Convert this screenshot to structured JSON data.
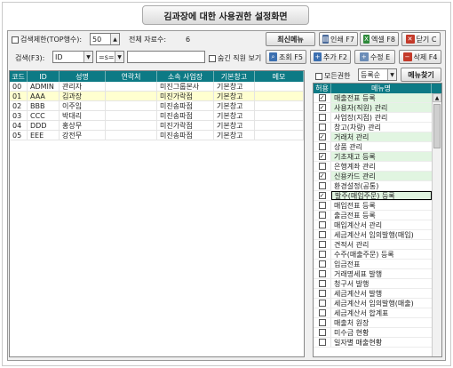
{
  "title": "김과장에 대한 사용권한 설정화면",
  "toolbar": {
    "limit_label": "검색제한(TOP행수):",
    "limit_value": "50",
    "total_label": "전체 자료수:",
    "total_value": "6",
    "refresh_label": "최신메뉴",
    "print_label": "인쇄 F7",
    "excel_label": "엑셀 F8",
    "close_label": "닫기 C"
  },
  "search": {
    "label": "검색(F3):",
    "field_value": "ID",
    "op_value": "=s=",
    "query_value": "",
    "hide_label": "숨긴 직원 보기",
    "query_btn": "조회 F5",
    "add_btn": "추가 F2",
    "edit_btn": "수정 E",
    "delete_btn": "삭제 F4"
  },
  "menu_panel": {
    "all_label": "모든권한",
    "mode_value": "등록순",
    "find_btn": "메뉴찾기",
    "col_allow": "허용",
    "col_menu": "메뉴명"
  },
  "grid": {
    "columns": [
      "코드",
      "ID",
      "성명",
      "연락처",
      "소속 사업장",
      "기본창고",
      "메모"
    ],
    "rows": [
      [
        "00",
        "ADMIN",
        "관리자",
        "",
        "미진그룹본사",
        "기본창고",
        ""
      ],
      [
        "01",
        "AAA",
        "김과장",
        "",
        "미진가락점",
        "기본창고",
        ""
      ],
      [
        "02",
        "BBB",
        "이주임",
        "",
        "미진송파점",
        "기본창고",
        ""
      ],
      [
        "03",
        "CCC",
        "박대리",
        "",
        "미진송파점",
        "기본창고",
        ""
      ],
      [
        "04",
        "DDD",
        "홍상무",
        "",
        "미진가락점",
        "기본창고",
        ""
      ],
      [
        "05",
        "EEE",
        "강전무",
        "",
        "미진송파점",
        "기본창고",
        ""
      ]
    ]
  },
  "menus": [
    {
      "name": "매출전표 등록",
      "checked": true,
      "hi": true
    },
    {
      "name": "사용자(직원) 관리",
      "checked": true,
      "hi": true
    },
    {
      "name": "사업장(지점) 관리",
      "checked": false,
      "hi": false
    },
    {
      "name": "창고(차량) 관리",
      "checked": false,
      "hi": false
    },
    {
      "name": "거래처 관리",
      "checked": true,
      "hi": true
    },
    {
      "name": "상품 관리",
      "checked": false,
      "hi": false
    },
    {
      "name": "기초재고 등록",
      "checked": true,
      "hi": true
    },
    {
      "name": "은행계좌 관리",
      "checked": false,
      "hi": false
    },
    {
      "name": "신용카드 관리",
      "checked": true,
      "hi": true
    },
    {
      "name": "환경설정(공통)",
      "checked": false,
      "hi": false
    },
    {
      "name": "발주(매입주문) 등록",
      "checked": true,
      "hi": true,
      "sel": true
    },
    {
      "name": "매입전표 등록",
      "checked": false,
      "hi": false
    },
    {
      "name": "출금전표 등록",
      "checked": false,
      "hi": false
    },
    {
      "name": "매입계산서 관리",
      "checked": false,
      "hi": false
    },
    {
      "name": "세금계산서 임의발행(매입)",
      "checked": false,
      "hi": false
    },
    {
      "name": "견적서 관리",
      "checked": false,
      "hi": false
    },
    {
      "name": "수주(매출주문) 등록",
      "checked": false,
      "hi": false
    },
    {
      "name": "입금전표",
      "checked": false,
      "hi": false
    },
    {
      "name": "거래명세표 발행",
      "checked": false,
      "hi": false
    },
    {
      "name": "청구서 발행",
      "checked": false,
      "hi": false
    },
    {
      "name": "세금계산서 발행",
      "checked": false,
      "hi": false
    },
    {
      "name": "세금계산서 임의발행(매출)",
      "checked": false,
      "hi": false
    },
    {
      "name": "세금계산서 합계표",
      "checked": false,
      "hi": false
    },
    {
      "name": "매출처 원장",
      "checked": false,
      "hi": false
    },
    {
      "name": "미수금 현황",
      "checked": false,
      "hi": false
    },
    {
      "name": "일자별 매출현황",
      "checked": false,
      "hi": false
    }
  ]
}
